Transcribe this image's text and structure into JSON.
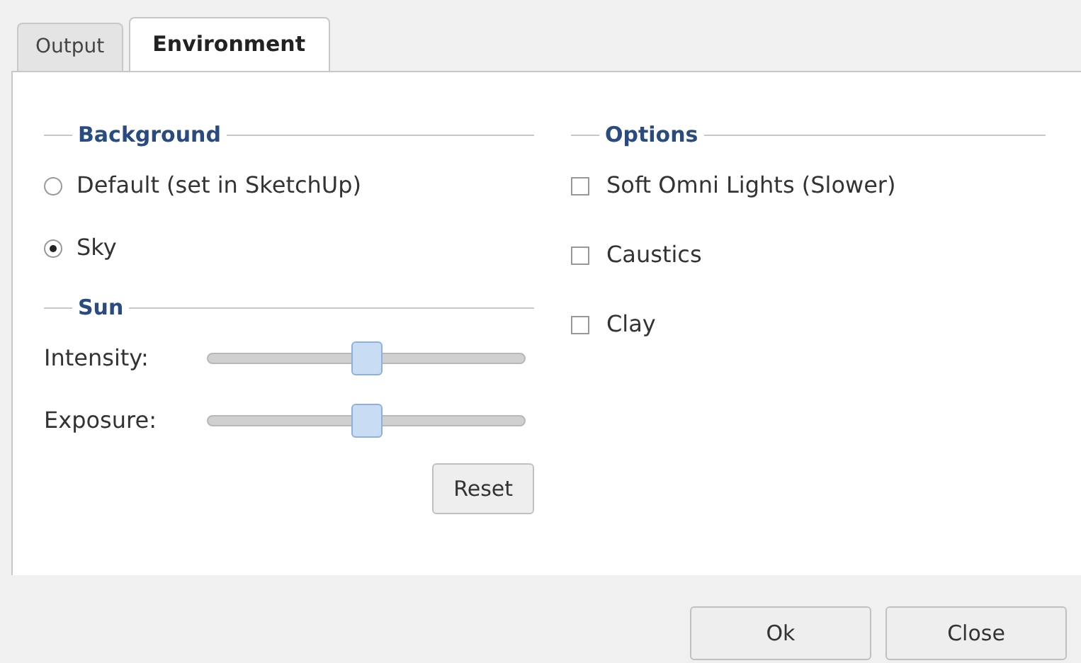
{
  "tabs": [
    {
      "label": "Output",
      "selected": false
    },
    {
      "label": "Environment",
      "selected": true
    }
  ],
  "background": {
    "heading": "Background",
    "options": [
      {
        "label": "Default (set in SketchUp)",
        "selected": false
      },
      {
        "label": "Sky",
        "selected": true
      }
    ]
  },
  "sun": {
    "heading": "Sun",
    "sliders": [
      {
        "label": "Intensity:",
        "level": 0.5
      },
      {
        "label": "Exposure:",
        "level": 0.5
      }
    ],
    "reset_button": "Reset"
  },
  "options": {
    "heading": "Options",
    "items": [
      {
        "label": "Soft Omni Lights (Slower)",
        "checked": false
      },
      {
        "label": "Caustics",
        "checked": false
      },
      {
        "label": "Clay",
        "checked": false
      }
    ]
  },
  "buttons": [
    "Ok",
    "Close"
  ]
}
